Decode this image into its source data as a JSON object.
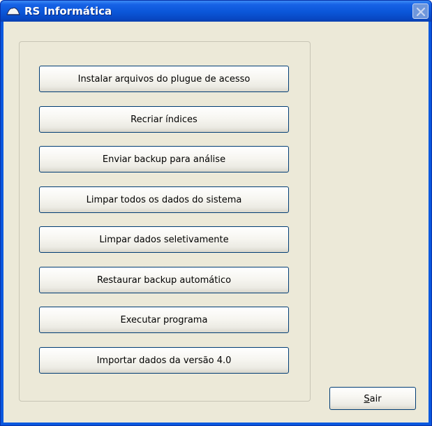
{
  "window": {
    "title": "RS Informática",
    "title_icon": "app-hat-icon",
    "close_icon": "close-icon"
  },
  "actions": [
    {
      "label": "Instalar arquivos do plugue de acesso"
    },
    {
      "label": "Recriar índices"
    },
    {
      "label": "Enviar backup para análise"
    },
    {
      "label": "Limpar todos os dados do sistema"
    },
    {
      "label": "Limpar dados seletivamente"
    },
    {
      "label": "Restaurar backup automático"
    },
    {
      "label": "Executar programa"
    },
    {
      "label": "Importar dados da versão 4.0"
    }
  ],
  "footer": {
    "exit_mnemonic": "S",
    "exit_rest": "air"
  },
  "colors": {
    "titlebar": "#0a56d8",
    "client_bg": "#ece9d8",
    "button_border": "#003c74"
  }
}
